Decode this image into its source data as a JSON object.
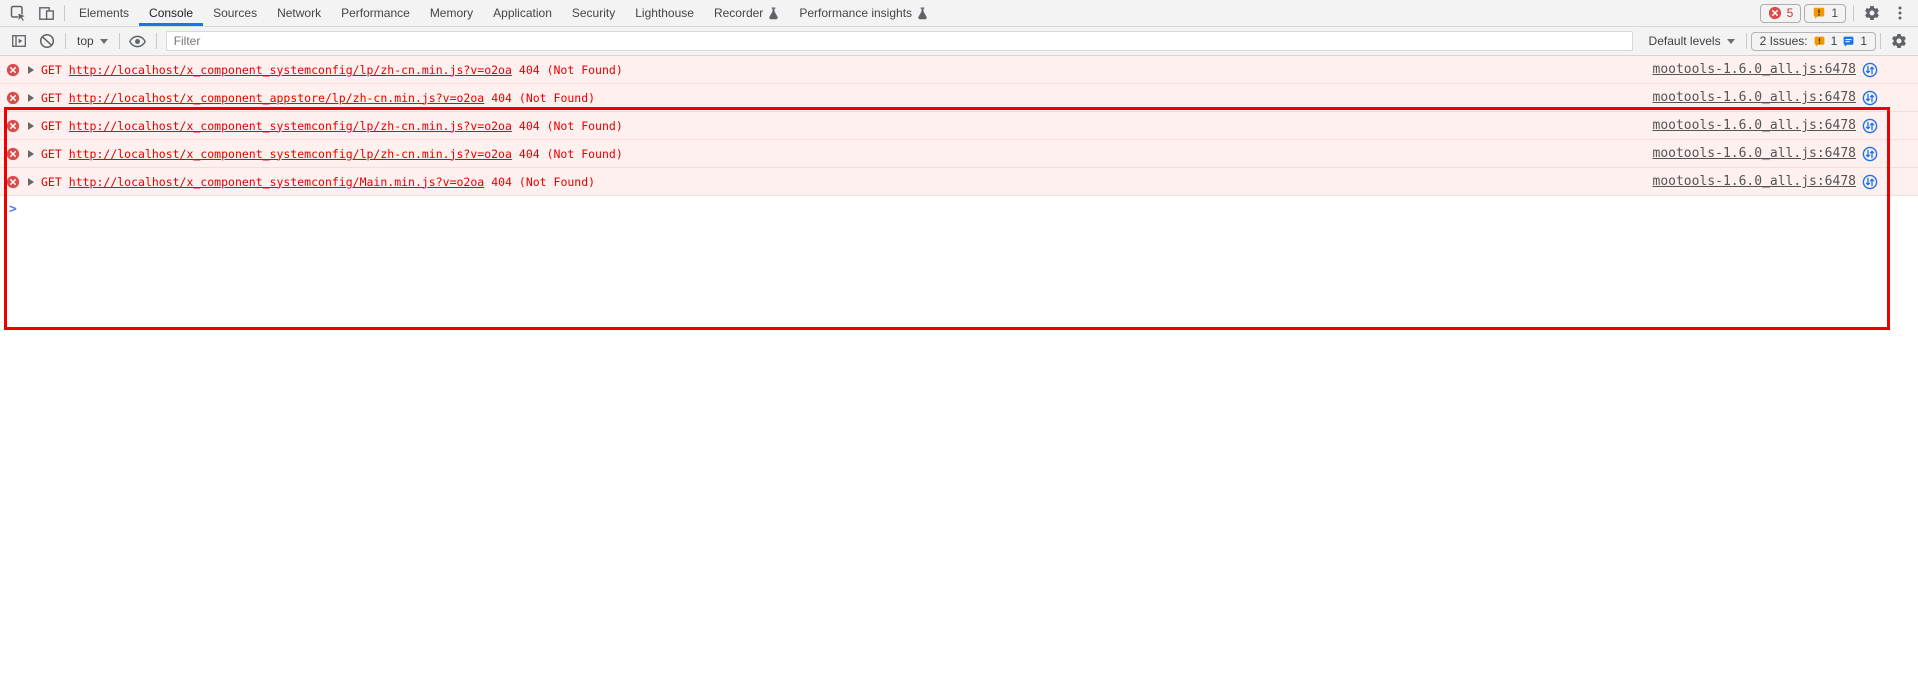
{
  "tab_bar": {
    "tabs": [
      {
        "label": "Elements"
      },
      {
        "label": "Console"
      },
      {
        "label": "Sources"
      },
      {
        "label": "Network"
      },
      {
        "label": "Performance"
      },
      {
        "label": "Memory"
      },
      {
        "label": "Application"
      },
      {
        "label": "Security"
      },
      {
        "label": "Lighthouse"
      },
      {
        "label": "Recorder"
      },
      {
        "label": "Performance insights"
      }
    ],
    "error_count": "5",
    "warning_count": "1"
  },
  "toolbar": {
    "context_label": "top",
    "filter_placeholder": "Filter",
    "levels_label": "Default levels",
    "issues_label": "2 Issues:",
    "issues_warning_count": "1",
    "issues_message_count": "1"
  },
  "console": {
    "messages": [
      {
        "method": "GET",
        "url": "http://localhost/x_component_systemconfig/lp/zh-cn.min.js?v=o2oa",
        "status": "404 (Not Found)",
        "source": "mootools-1.6.0_all.js:6478"
      },
      {
        "method": "GET",
        "url": "http://localhost/x_component_appstore/lp/zh-cn.min.js?v=o2oa",
        "status": "404 (Not Found)",
        "source": "mootools-1.6.0_all.js:6478"
      },
      {
        "method": "GET",
        "url": "http://localhost/x_component_systemconfig/lp/zh-cn.min.js?v=o2oa",
        "status": "404 (Not Found)",
        "source": "mootools-1.6.0_all.js:6478"
      },
      {
        "method": "GET",
        "url": "http://localhost/x_component_systemconfig/lp/zh-cn.min.js?v=o2oa",
        "status": "404 (Not Found)",
        "source": "mootools-1.6.0_all.js:6478"
      },
      {
        "method": "GET",
        "url": "http://localhost/x_component_systemconfig/Main.min.js?v=o2oa",
        "status": "404 (Not Found)",
        "source": "mootools-1.6.0_all.js:6478"
      }
    ],
    "prompt": ">"
  },
  "colors": {
    "accent": "#1a73e8",
    "error_text": "#e60000",
    "error_row_bg": "#fff0f0",
    "annotation": "#ec0000",
    "warning": "#f29900"
  }
}
